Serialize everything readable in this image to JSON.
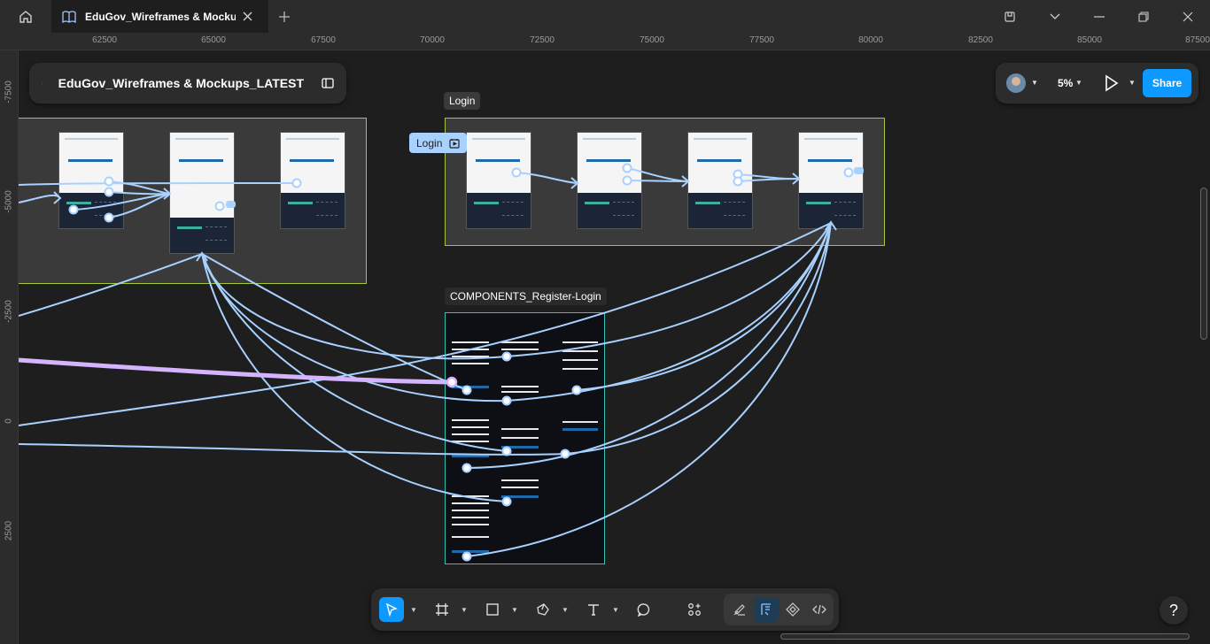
{
  "tab": {
    "title": "EduGov_Wireframes & Mockups_LATEST"
  },
  "ruler": {
    "x_ticks": [
      "62500",
      "65000",
      "67500",
      "70000",
      "72500",
      "75000",
      "77500",
      "80000",
      "82500",
      "85000",
      "87500"
    ],
    "y_ticks": [
      "-7500",
      "-5000",
      "-2500",
      "0",
      "2500"
    ]
  },
  "file": {
    "title": "EduGov_Wireframes & Mockups_LATEST"
  },
  "canvas": {
    "login_frame_label": "Login",
    "login_chip_label": "Login",
    "components_label": "COMPONENTS_Register-Login",
    "connector_color": "#a8d1ff",
    "selected_connector_color": "#d4b3ff",
    "frame_border_color": "#a4c639",
    "components_border_color": "#2ec4b6"
  },
  "header_right": {
    "zoom": "5%",
    "share_label": "Share"
  },
  "toolbar": {
    "tools": [
      "move-tool",
      "frame-tool",
      "shape-tool",
      "pen-tool",
      "text-tool",
      "comment-tool",
      "actions-tool"
    ],
    "modes": [
      "draw-mode",
      "design-mode",
      "dev-components-mode",
      "dev-mode"
    ]
  },
  "help": {
    "label": "?"
  },
  "accent": "#0d99ff"
}
